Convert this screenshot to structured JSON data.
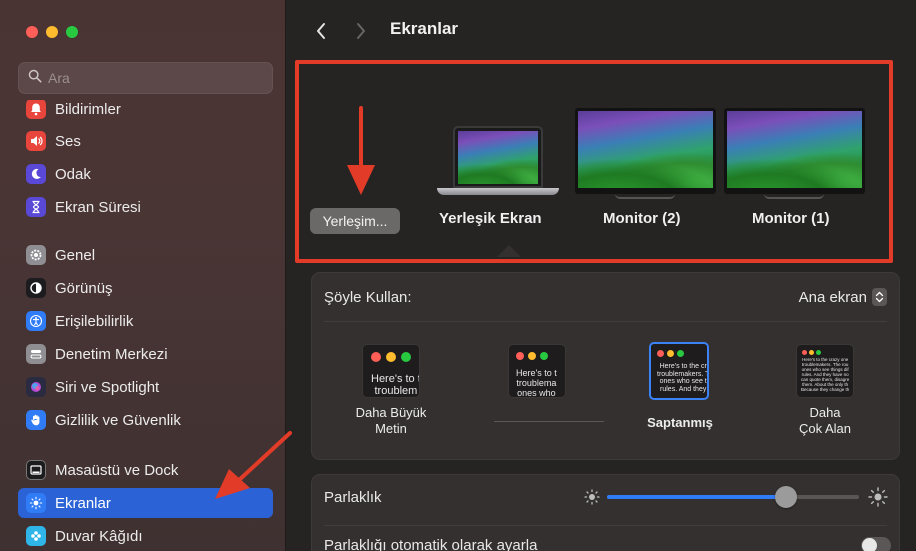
{
  "window": {
    "traffic_lights": {
      "close": "#ff5f57",
      "minimize": "#febc2e",
      "maximize": "#28c840"
    }
  },
  "sidebar": {
    "search_placeholder": "Ara",
    "items": [
      {
        "label": "Bildirimler",
        "icon": "bell-icon",
        "color": "#e8453c"
      },
      {
        "label": "Ses",
        "icon": "speaker-icon",
        "color": "#e8453c"
      },
      {
        "label": "Odak",
        "icon": "moon-icon",
        "color": "#5a48d6"
      },
      {
        "label": "Ekran Süresi",
        "icon": "hourglass-icon",
        "color": "#5a48d6"
      },
      {
        "label": "Genel",
        "icon": "gear-icon",
        "color": "#8e8e93"
      },
      {
        "label": "Görünüş",
        "icon": "appearance-icon",
        "color": "#1c1c1e"
      },
      {
        "label": "Erişilebilirlik",
        "icon": "accessibility-icon",
        "color": "#2f7cf6"
      },
      {
        "label": "Denetim Merkezi",
        "icon": "control-center-icon",
        "color": "#8e8e93"
      },
      {
        "label": "Siri ve Spotlight",
        "icon": "siri-icon",
        "color": "#2a2a40"
      },
      {
        "label": "Gizlilik ve Güvenlik",
        "icon": "hand-icon",
        "color": "#2f7cf6"
      },
      {
        "label": "Masaüstü ve Dock",
        "icon": "dock-icon",
        "color": "#1c1c1e"
      },
      {
        "label": "Ekranlar",
        "icon": "sun-icon",
        "color": "#2f7cf6",
        "active": true
      },
      {
        "label": "Duvar Kâğıdı",
        "icon": "wallpaper-icon",
        "color": "#2fb5e8"
      }
    ],
    "active_color": "#2b63d6"
  },
  "header": {
    "title": "Ekranlar"
  },
  "displays": {
    "arrange_button": "Yerleşim...",
    "items": [
      {
        "label": "Yerleşik Ekran",
        "selected": true
      },
      {
        "label": "Monitor (2)"
      },
      {
        "label": "Monitor (1)"
      }
    ]
  },
  "use_as": {
    "label": "Şöyle Kullan:",
    "value": "Ana ekran",
    "options": [
      {
        "label_line1": "Daha Büyük",
        "label_line2": "Metin",
        "preview": "Here's to t\ntroublem"
      },
      {
        "label_line1": "",
        "label_line2": "",
        "preview": "Here's to t\ntroublema\nones who"
      },
      {
        "label_line1": "Saptanmış",
        "label_line2": "",
        "preview": "Here's to the cr\ntroublemakers. T\nones who see t\nrules. And they",
        "selected": true
      },
      {
        "label_line1": "Daha",
        "label_line2": "Çok Alan",
        "preview": "Here's to the crazy one\ntroublemakers. The rou\nones who see things dif\nrules. And they have no\ncan quote them, disagre\nthem. About the only th\nBecause they change th"
      }
    ]
  },
  "brightness": {
    "label": "Parlaklık",
    "value": 0.71
  },
  "auto_brightness": {
    "label": "Parlaklığı otomatik olarak ayarla",
    "enabled": false
  },
  "annotation_color": "#e23c28"
}
